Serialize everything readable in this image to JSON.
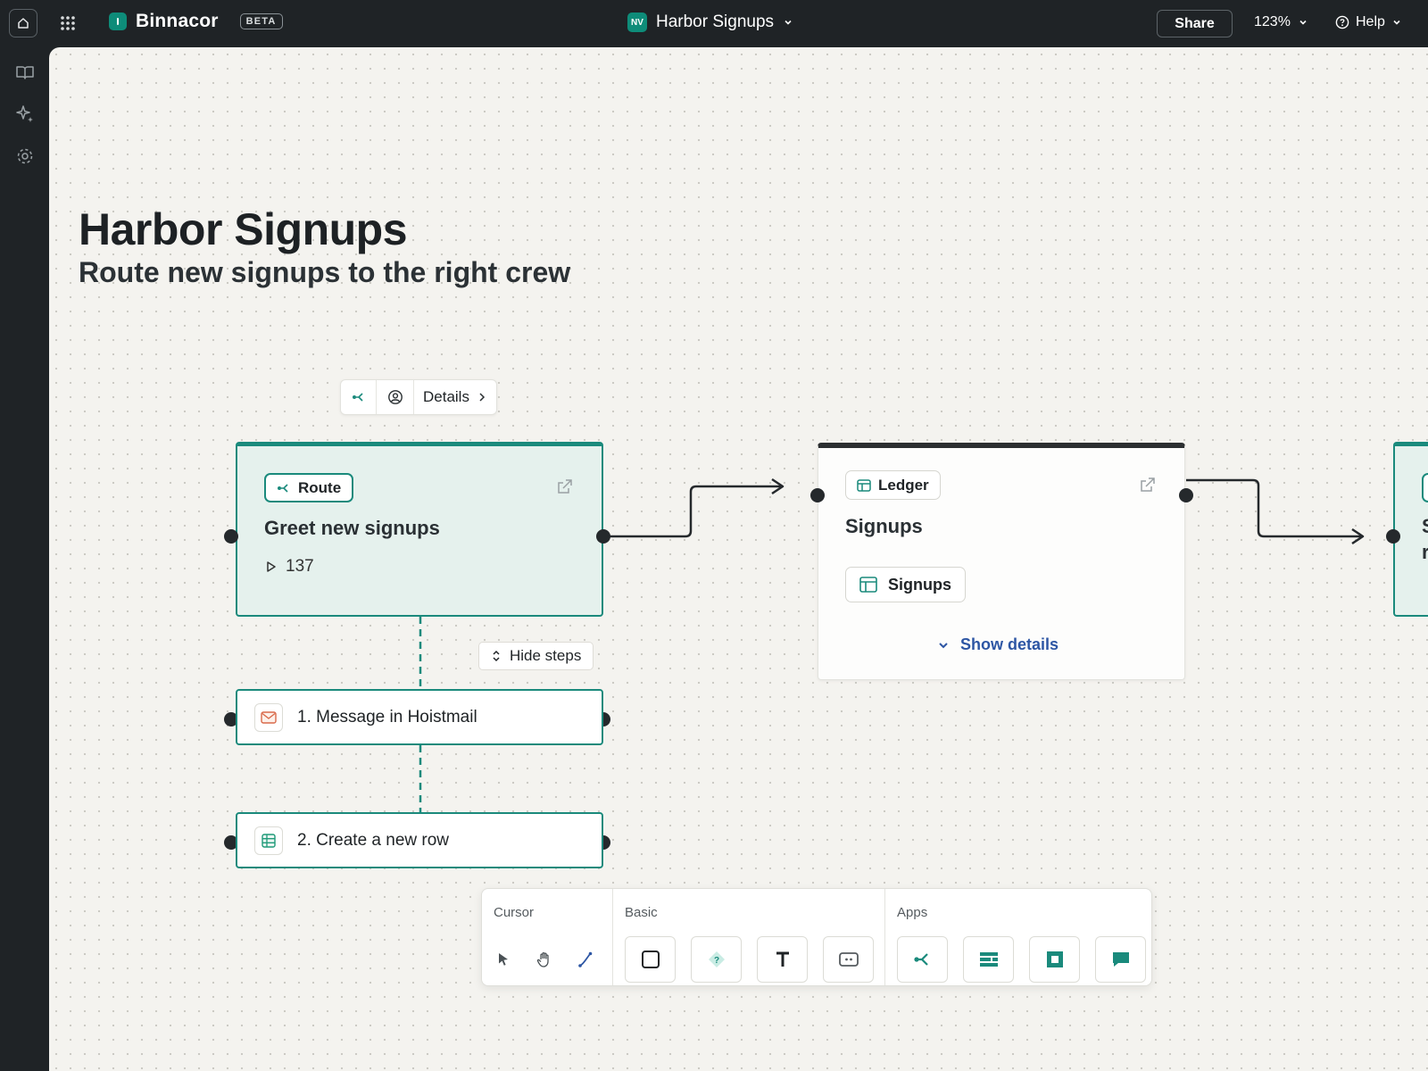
{
  "app": {
    "brand_name": "Binnacor",
    "badge": "BETA",
    "avatar_initials": "NV",
    "doc_name": "Harbor Signups",
    "share_label": "Share",
    "zoom": "123%",
    "help_label": "Help",
    "accent": "#1a8a7c"
  },
  "rail": {
    "icons": [
      "book-icon",
      "sparkle-icon",
      "gear-icon"
    ]
  },
  "canvas": {
    "title": "Harbor Signups",
    "subtitle": "Route new signups to the right crew"
  },
  "node_toolbar": {
    "icons": [
      "route-icon",
      "user-circle-icon"
    ],
    "details_label": "Details"
  },
  "route_card": {
    "tag": "Route",
    "title": "Greet new signups",
    "run_count": "137"
  },
  "steps": {
    "toggle_label": "Hide steps",
    "items": [
      {
        "label": "1. Message in Hoistmail",
        "icon": "mail-icon"
      },
      {
        "label": "2. Create a new row",
        "icon": "table-icon"
      }
    ]
  },
  "ledger_card": {
    "tag": "Ledger",
    "title": "Signups",
    "chip": "Signups",
    "show_details": "Show details"
  },
  "partial_card": {
    "line1": "S",
    "line2": "r"
  },
  "palette": {
    "cursor_label": "Cursor",
    "basic_label": "Basic",
    "apps_label": "Apps",
    "cursor_tools": [
      "pointer-icon",
      "hand-icon",
      "connector-icon"
    ],
    "basic_tools": [
      "square-icon",
      "decision-icon",
      "text-icon",
      "button-icon"
    ],
    "app_tools": [
      "route-icon",
      "interface-icon",
      "ledger-block-icon",
      "chat-icon"
    ]
  }
}
